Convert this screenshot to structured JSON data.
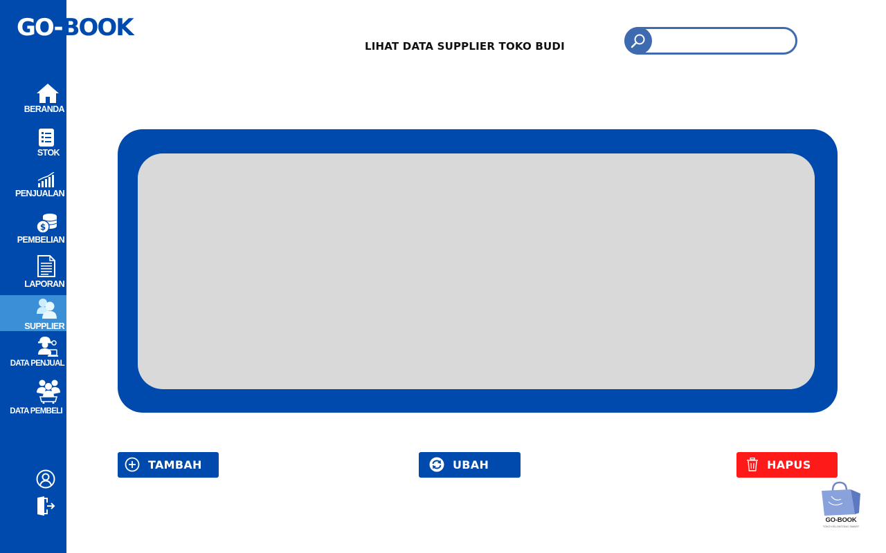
{
  "brand": {
    "name_prefix": "GO-",
    "name_suffix": "BOOK"
  },
  "header": {
    "title": "LIHAT DATA SUPPLIER TOKO BUDI"
  },
  "search": {
    "placeholder": "",
    "value": ""
  },
  "sidebar": {
    "items": [
      {
        "label": "BERANDA",
        "icon": "home-icon"
      },
      {
        "label": "STOK",
        "icon": "stock-list-icon"
      },
      {
        "label": "PENJUALAN",
        "icon": "sales-chart-icon"
      },
      {
        "label": "PEMBELIAN",
        "icon": "coins-icon"
      },
      {
        "label": "LAPORAN",
        "icon": "report-document-icon"
      },
      {
        "label": "SUPPLIER",
        "icon": "supplier-users-icon",
        "active": true
      },
      {
        "label": "DATA PENJUAL",
        "icon": "seller-icon"
      },
      {
        "label": "DATA PEMBELI",
        "icon": "buyers-icon"
      }
    ],
    "bottom": [
      {
        "icon": "profile-icon"
      },
      {
        "icon": "logout-icon"
      }
    ]
  },
  "actions": {
    "add_label": "TAMBAH",
    "edit_label": "UBAH",
    "delete_label": "HAPUS"
  },
  "corner_logo": {
    "word": "GO-BOOK",
    "tagline": "TOKO KELONTONG SMART"
  },
  "colors": {
    "primary": "#004aad",
    "active_item": "#3a8fd6",
    "table_bg": "#d9d9d9",
    "delete": "#ff1a1a",
    "search_border": "#3e6bb0"
  }
}
